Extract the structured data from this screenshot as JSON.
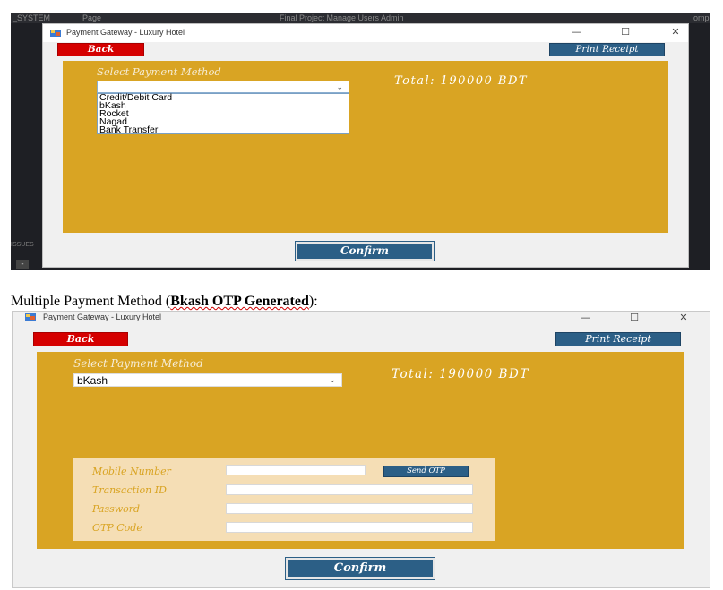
{
  "shot1": {
    "ide": {
      "top_left": "_SYSTEM",
      "top_middle": "Page",
      "top_center": "Final Project Manage Users Admin",
      "top_right": "omp",
      "side_label": "ISSUES",
      "bottom_button": "-"
    },
    "window": {
      "title": "Payment Gateway - Luxury Hotel",
      "minimize": "—",
      "maximize": "☐",
      "close": "✕"
    },
    "back_label": "Back",
    "print_label": "Print Receipt",
    "select_label": "Select Payment Method",
    "combo_value": "",
    "dropdown_options": [
      "Credit/Debit Card",
      "bKash",
      "Rocket",
      "Nagad",
      "Bank Transfer"
    ],
    "total": "Total: 190000 BDT",
    "confirm_label": "Confirm"
  },
  "caption": {
    "prefix": "Multiple Payment Method (",
    "bold": "Bkash OTP Generated",
    "suffix": "):"
  },
  "shot2": {
    "window": {
      "title": "Payment Gateway - Luxury Hotel",
      "minimize": "—",
      "maximize": "☐",
      "close": "✕"
    },
    "back_label": "Back",
    "print_label": "Print Receipt",
    "select_label": "Select Payment Method",
    "combo_value": "bKash",
    "total": "Total: 190000 BDT",
    "fields": {
      "mobile_label": "Mobile Number",
      "transaction_label": "Transaction ID",
      "password_label": "Password",
      "otp_label": "OTP Code"
    },
    "send_otp_label": "Send OTP",
    "confirm_label": "Confirm"
  },
  "colors": {
    "panel": "#d9a423",
    "form_box": "#f5deb5",
    "back_button": "#d50000",
    "blue_button": "#2c5f86",
    "window_bg": "#f0f0f0"
  },
  "icons": {
    "app_icon": "hotel-app-icon",
    "combo_chevron": "chevron-down-icon"
  }
}
